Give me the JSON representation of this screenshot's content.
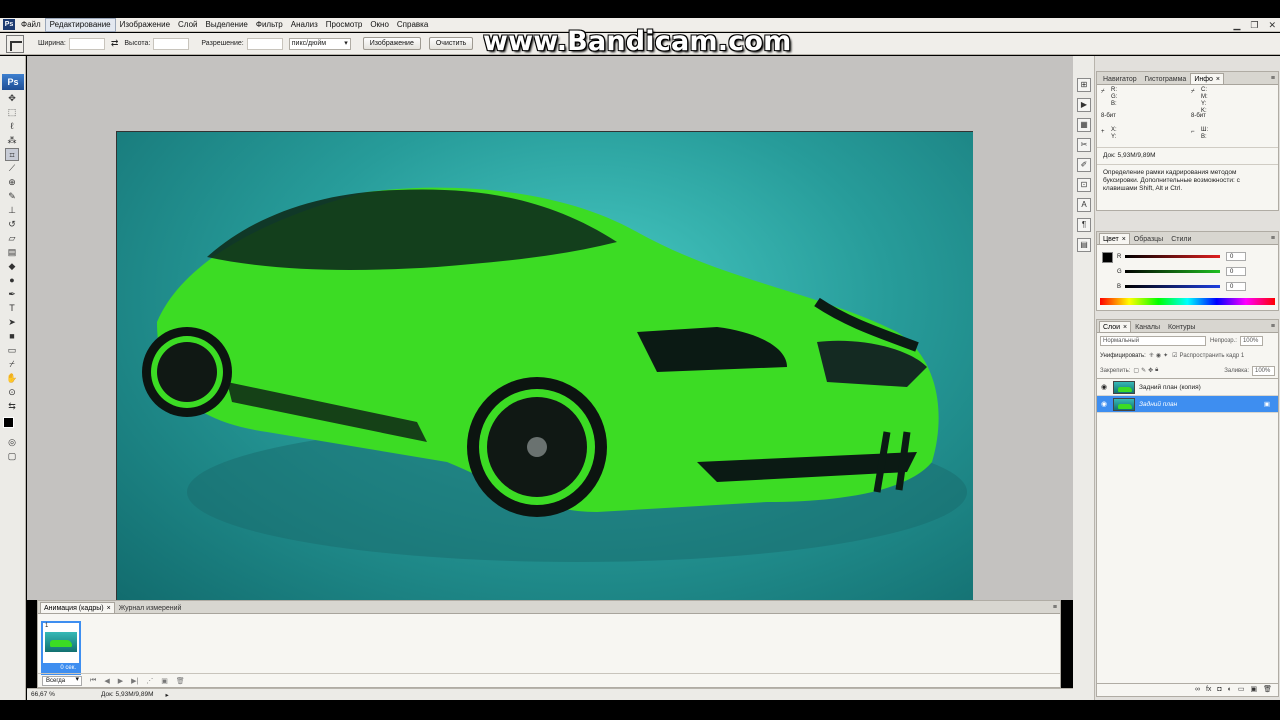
{
  "menubar": {
    "items": [
      "Файл",
      "Редактирование",
      "Изображение",
      "Слой",
      "Выделение",
      "Фильтр",
      "Анализ",
      "Просмотр",
      "Окно",
      "Справка"
    ],
    "active_index": 1
  },
  "options": {
    "width_label": "Ширина:",
    "height_label": "Высота:",
    "resolution_label": "Разрешение:",
    "units_value": "пикс/дюйм",
    "image_button": "Изображение",
    "clear_button": "Очистить"
  },
  "watermark": "www.Bandicam.com",
  "toolbox": {
    "logo": "Ps"
  },
  "info_panel": {
    "tabs": [
      "Навигатор",
      "Гистограмма",
      "Инфо"
    ],
    "rgb_labels": "R:\nG:\nB:",
    "cmyk_labels": "C:\nM:\nY:\nK:",
    "bit_left": "8-бит",
    "bit_right": "8-бит",
    "xy_labels": "X:\nY:",
    "wh_labels": "Ш:\nВ:",
    "doc_size": "Док: 5,93M/9,89M",
    "hint": "Определение рамки кадрирования методом буксировки.  Дополнительные возможности: с клавишами Shift, Alt и Ctrl."
  },
  "color_panel": {
    "tabs": [
      "Цвет",
      "Образцы",
      "Стили"
    ],
    "channels": [
      {
        "label": "R",
        "value": "0",
        "color": "#e02020"
      },
      {
        "label": "G",
        "value": "0",
        "color": "#20c020"
      },
      {
        "label": "B",
        "value": "0",
        "color": "#2040e0"
      }
    ],
    "foreground": "#000000"
  },
  "layers_panel": {
    "tabs": [
      "Слои",
      "Каналы",
      "Контуры"
    ],
    "blend_mode": "Нормальный",
    "opacity_label": "Непрозр.:",
    "opacity_value": "100%",
    "unify_label": "Унифицировать:",
    "propagate_label": "Распространить кадр 1",
    "lock_label": "Закрепить:",
    "fill_label": "Заливка:",
    "fill_value": "100%",
    "layers": [
      {
        "name": "Задний план (копия)",
        "selected": false
      },
      {
        "name": "Задний план",
        "selected": true
      }
    ]
  },
  "animation_panel": {
    "tabs": [
      "Анимация (кадры)",
      "Журнал измерений"
    ],
    "frame_number": "1",
    "frame_delay": "0 сек.",
    "loop_value": "Всегда"
  },
  "status": {
    "zoom": "66,67 %",
    "doc_size": "Док: 5,93M/9,89M"
  },
  "colors": {
    "selection_blue": "#3e8ef0",
    "car_green": "#3cdc24",
    "background_teal": "#279c9a"
  }
}
